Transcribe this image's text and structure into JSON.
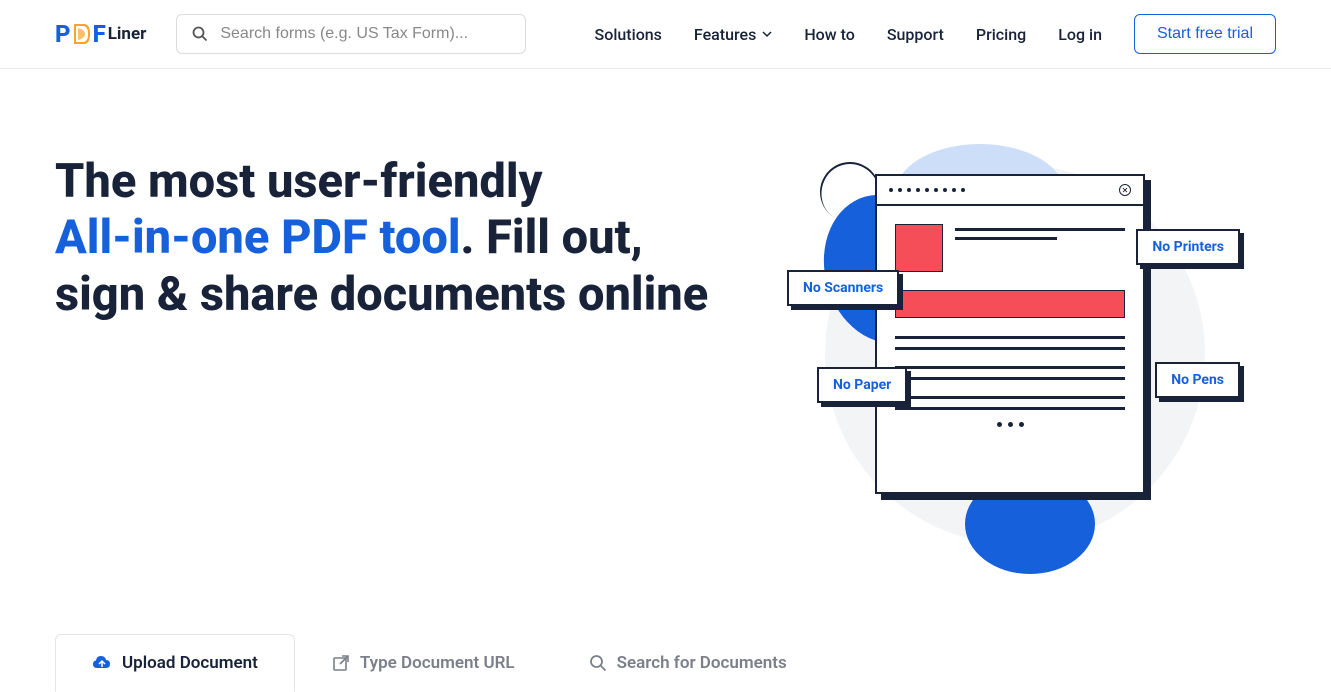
{
  "logo": {
    "text_p": "P",
    "text_f": "F",
    "text_liner": "Liner"
  },
  "search": {
    "placeholder": "Search forms (e.g. US Tax Form)..."
  },
  "nav": {
    "solutions": "Solutions",
    "features": "Features",
    "howto": "How to",
    "support": "Support",
    "pricing": "Pricing",
    "login": "Log in"
  },
  "cta": "Start free trial",
  "hero": {
    "line1": "The most user-friendly",
    "highlight": "All-in-one PDF tool",
    "line2_start": ". Fill out,",
    "line3": "sign & share documents online"
  },
  "badges": {
    "scanners": "No Scanners",
    "printers": "No Printers",
    "paper": "No Paper",
    "pens": "No Pens"
  },
  "tabs": {
    "upload": "Upload Document",
    "url": "Type Document URL",
    "search": "Search for Documents"
  }
}
